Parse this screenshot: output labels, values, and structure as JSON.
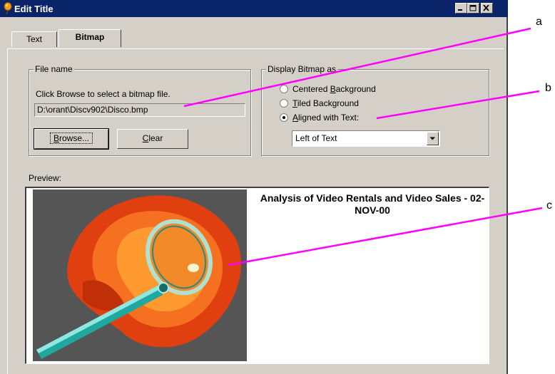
{
  "window": {
    "title": "Edit Title"
  },
  "tabs": [
    {
      "label": "Text",
      "active": false
    },
    {
      "label": "Bitmap",
      "active": true
    }
  ],
  "file_group": {
    "label": "File name",
    "instruction": "Click Browse to select a bitmap file.",
    "path_value": "D:\\orant\\Discv902\\Disco.bmp",
    "browse_label": "Browse...",
    "clear_label": "Clear"
  },
  "display_group": {
    "label": "Display Bitmap as",
    "options": [
      {
        "label": "Centered Background",
        "selected": false
      },
      {
        "label": "Tiled Background",
        "selected": false
      },
      {
        "label": "Aligned with Text:",
        "selected": true
      }
    ],
    "alignment_value": "Left of Text"
  },
  "preview": {
    "label": "Preview:",
    "title": "Analysis of Video Rentals and Video Sales  - 02-NOV-00",
    "image_icon": "magnifying-glass-image"
  },
  "callouts": {
    "a": "a",
    "b": "b",
    "c": "c"
  },
  "colors": {
    "titlebar": "#0a246a",
    "dialog_bg": "#d4d0c8",
    "callout_line": "#ff00ff"
  }
}
